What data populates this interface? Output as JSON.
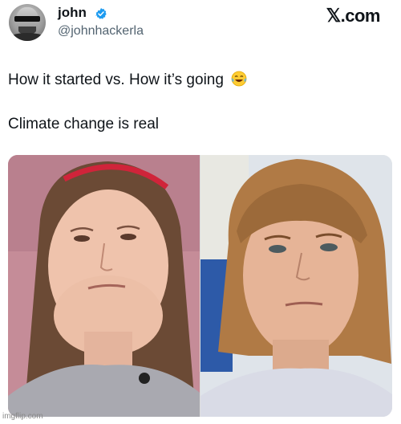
{
  "author": {
    "name": "john",
    "handle": "@johnhackerla",
    "avatar_icon": "profile-avatar",
    "verified_icon": "verified-badge-icon",
    "verified_color": "#1d9bf0"
  },
  "brand": {
    "label": ".com",
    "logo_icon": "x-logo-icon"
  },
  "post": {
    "line1": "How it started vs. How it’s going",
    "line1_emoji": "face-with-tears-of-joy-icon",
    "line2": "Climate change is real",
    "media_icon": "photo-collage"
  },
  "watermark": "imgflip.com",
  "colors": {
    "text": "#0f1419",
    "secondary": "#536471"
  }
}
